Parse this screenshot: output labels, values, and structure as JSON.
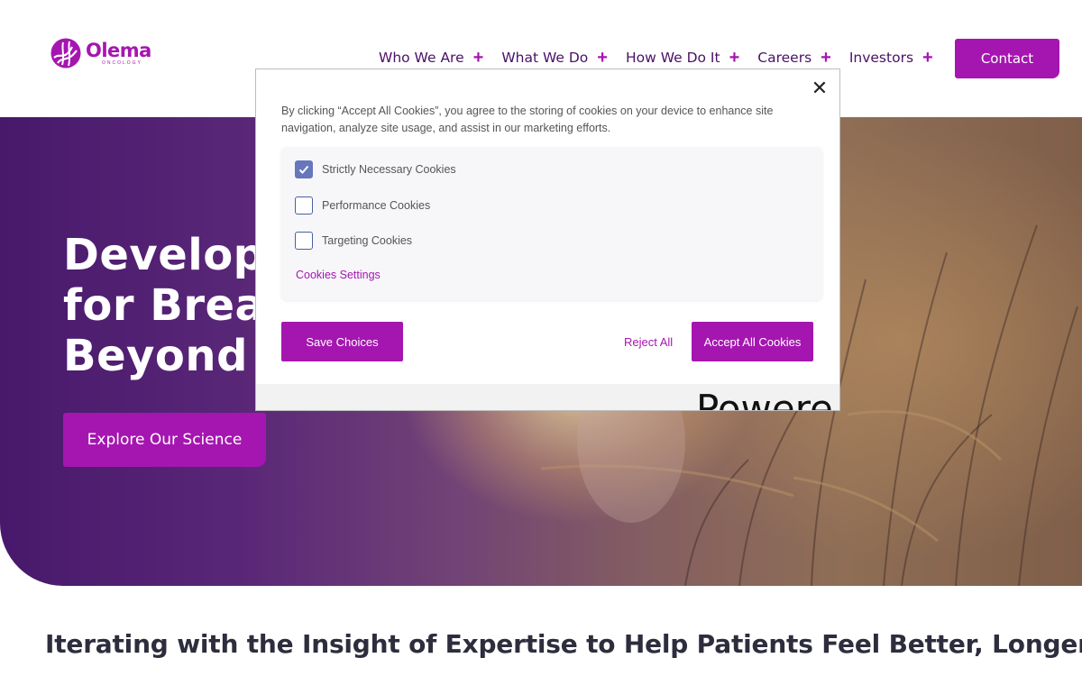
{
  "header": {
    "logo": {
      "name": "Olema",
      "subtitle": "ONCOLOGY",
      "icon": "olema-logo-icon"
    },
    "nav": [
      {
        "label": "Who We Are",
        "icon": "plus-icon"
      },
      {
        "label": "What We Do",
        "icon": "plus-icon"
      },
      {
        "label": "How We Do It",
        "icon": "plus-icon"
      },
      {
        "label": "Careers",
        "icon": "plus-icon"
      },
      {
        "label": "Investors",
        "icon": "plus-icon"
      }
    ],
    "contact_label": "Contact"
  },
  "hero": {
    "title_lines": [
      "Developi",
      "for Breast",
      "Beyond"
    ],
    "cta_label": "Explore Our Science"
  },
  "cookie_modal": {
    "close_icon": "close-icon",
    "description": "By clicking “Accept All Cookies”, you agree to the storing of cookies on your device to enhance site navigation, analyze site usage, and assist in our marketing efforts.",
    "options": [
      {
        "label": "Strictly Necessary Cookies",
        "checked": true
      },
      {
        "label": "Performance Cookies",
        "checked": false
      },
      {
        "label": "Targeting Cookies",
        "checked": false
      }
    ],
    "settings_link": "Cookies Settings",
    "save_label": "Save Choices",
    "reject_label": "Reject All",
    "accept_label": "Accept All Cookies",
    "peek_text": "Powere"
  },
  "section": {
    "heading": "Iterating with the Insight of Expertise to Help Patients Feel Better, Longer"
  },
  "colors": {
    "brand": "#a516b0",
    "nav_text": "#4a1266",
    "checkbox_checked": "#6677bb"
  }
}
